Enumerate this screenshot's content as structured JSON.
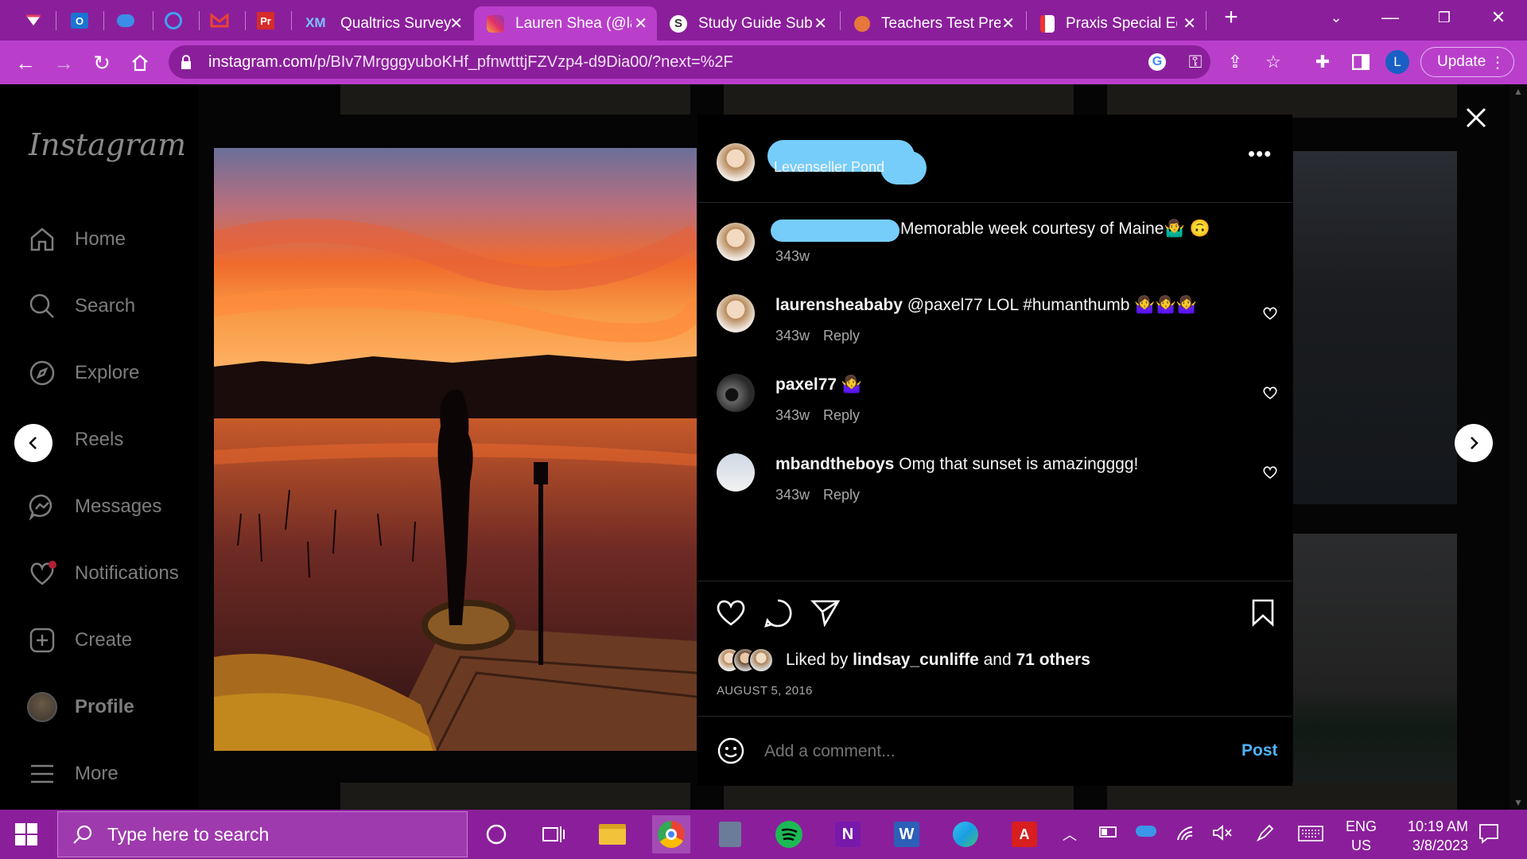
{
  "browser": {
    "tabs": [
      {
        "label": "Qualtrics Survey |",
        "favicon": "qualtrics-icon"
      },
      {
        "label": "Lauren Shea (@la",
        "favicon": "instagram-icon",
        "active": true
      },
      {
        "label": "Study Guide Sub",
        "favicon": "study-icon"
      },
      {
        "label": "Teachers Test Pre",
        "favicon": "teachers-icon"
      },
      {
        "label": "Praxis Special Ed",
        "favicon": "praxis-icon"
      }
    ],
    "url_host": "instagram.com",
    "url_path": "/p/BIv7MrgggyuboKHf_pfnwtttjFZVzp4-d9Dia00/?next=%2F",
    "profile_initial": "L",
    "update_label": "Update"
  },
  "sidebar": {
    "logo": "Instagram",
    "items": [
      {
        "label": "Home",
        "icon": "home-icon"
      },
      {
        "label": "Search",
        "icon": "search-icon"
      },
      {
        "label": "Explore",
        "icon": "explore-icon"
      },
      {
        "label": "Reels",
        "icon": "reels-icon"
      },
      {
        "label": "Messages",
        "icon": "messages-icon"
      },
      {
        "label": "Notifications",
        "icon": "heart-icon"
      },
      {
        "label": "Create",
        "icon": "create-icon"
      },
      {
        "label": "Profile",
        "icon": "avatar"
      },
      {
        "label": "More",
        "icon": "menu-icon"
      }
    ]
  },
  "post": {
    "location": "Levenseller Pond",
    "caption": "Memorable week courtesy of Maine🤷‍♂️ 🙃",
    "caption_time": "343w",
    "comments": [
      {
        "user": "laurensheababy",
        "text": " @paxel77 LOL #humanthumb 🤷‍♀️🤷‍♀️🤷‍♀️",
        "time": "343w",
        "reply": "Reply"
      },
      {
        "user": "paxel77",
        "text": " 🤷‍♀️",
        "time": "343w",
        "reply": "Reply"
      },
      {
        "user": "mbandtheboys",
        "text": " Omg that sunset is amazingggg!",
        "time": "343w",
        "reply": "Reply"
      }
    ],
    "liked_prefix": "Liked by ",
    "liked_user": "lindsay_cunliffe",
    "liked_and": " and ",
    "liked_others": "71 others",
    "date": "AUGUST 5, 2016",
    "comment_placeholder": "Add a comment...",
    "post_button": "Post"
  },
  "taskbar": {
    "search_placeholder": "Type here to search",
    "lang": "ENG",
    "region": "US",
    "time": "10:19 AM",
    "date": "3/8/2023"
  }
}
